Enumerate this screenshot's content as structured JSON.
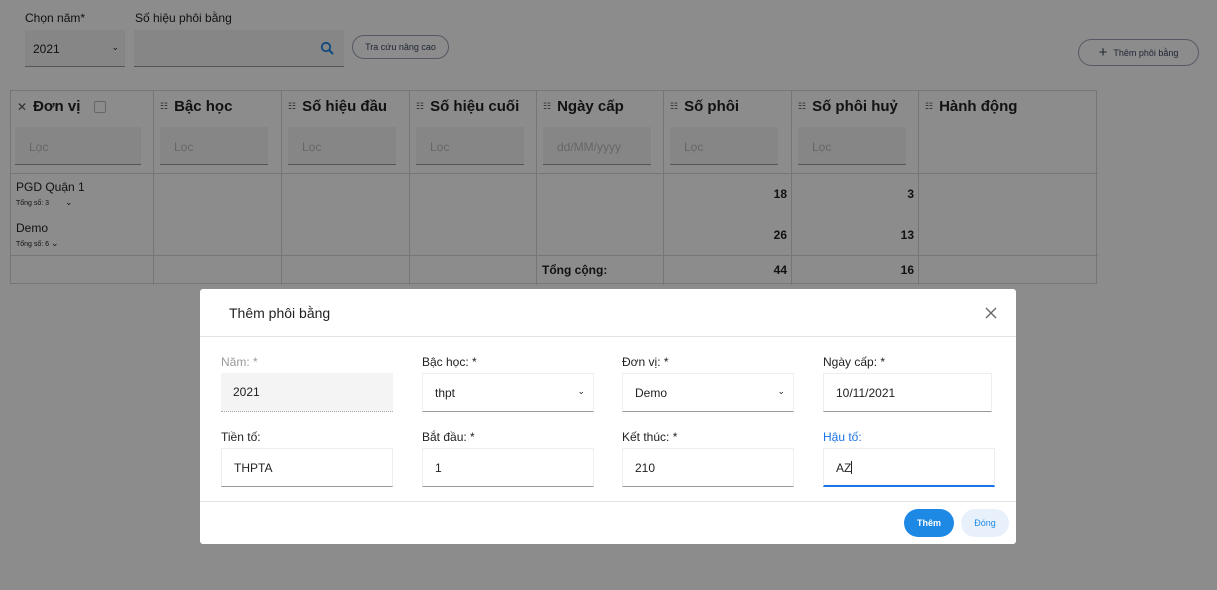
{
  "filters": {
    "year_label": "Chọn năm",
    "year_required": "*",
    "year_value": "2021",
    "serial_label": "Số hiệu phôi bằng",
    "advanced_search_label": "Tra cứu nâng cao",
    "add_button_label": "Thêm phôi bằng"
  },
  "table": {
    "headers": [
      "Đơn vị",
      "Bậc học",
      "Số hiệu đầu",
      "Số hiệu cuối",
      "Ngày cấp",
      "Số phôi",
      "Số phôi huỷ",
      "Hành động"
    ],
    "filter_placeholder": "Lọc",
    "date_placeholder": "dd/MM/yyyy",
    "rows": [
      {
        "unit": "PGD Quận 1",
        "total_label": "Tổng số: 3",
        "so_phoi": "18",
        "so_phoi_huy": "3"
      },
      {
        "unit": "Demo",
        "total_label": "Tổng số: 6",
        "so_phoi": "26",
        "so_phoi_huy": "13"
      }
    ],
    "footer": {
      "label": "Tổng cộng:",
      "so_phoi": "44",
      "so_phoi_huy": "16"
    }
  },
  "modal": {
    "title": "Thêm phôi bằng",
    "fields": {
      "nam": {
        "label": "Năm: *",
        "value": "2021"
      },
      "bac_hoc": {
        "label": "Bậc học: *",
        "value": "thpt"
      },
      "don_vi": {
        "label": "Đơn vị: *",
        "value": "Demo"
      },
      "ngay_cap": {
        "label": "Ngày cấp: *",
        "value": "10/11/2021"
      },
      "tien_to": {
        "label": "Tiền tố:",
        "value": "THPTA"
      },
      "bat_dau": {
        "label": "Bắt đầu: *",
        "value": "1"
      },
      "ket_thuc": {
        "label": "Kết thúc: *",
        "value": "210"
      },
      "hau_to": {
        "label": "Hậu tố:",
        "value": "AZ"
      }
    },
    "submit_label": "Thêm",
    "close_label": "Đóng"
  },
  "colors": {
    "primary": "#1e88e5",
    "overlay": "rgba(0,0,0,0.45)"
  }
}
